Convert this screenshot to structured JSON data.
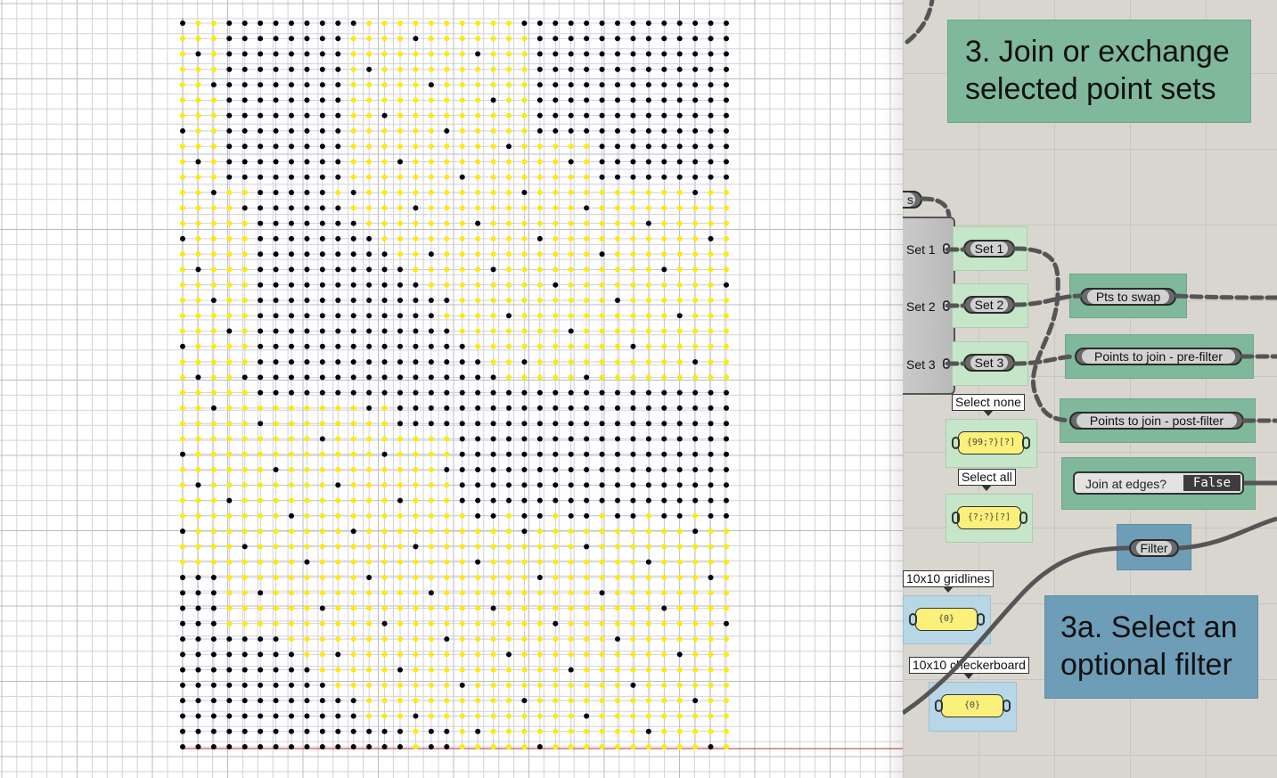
{
  "viewport": {
    "grid_cols": 36,
    "grid_rows": 48,
    "point_colors": {
      "selected": "#ffeb00",
      "unselected": "#000000"
    }
  },
  "canvas": {
    "note_join": "3. Join or exchange\nselected point sets",
    "note_filter": "3a. Select an\noptional filter",
    "param_s": "s",
    "component_outputs": [
      "Set 1",
      "Set 2",
      "Set 3"
    ],
    "set_params": [
      "Set 1",
      "Set 2",
      "Set 3"
    ],
    "pts_to_swap": "Pts to swap",
    "points_join_pre": "Points to join - pre-filter",
    "points_join_post": "Points to join - post-filter",
    "select_none_label": "Select none",
    "select_none_value": "{99;?}[?]",
    "select_all_label": "Select all",
    "select_all_value": "{?;?}[?]",
    "join_edges_label": "Join at edges?",
    "join_edges_value": "False",
    "filter_label": "Filter",
    "gridlines_label": "10x10 gridlines",
    "gridlines_value": "{0}",
    "checker_label": "10x10 checkerboard",
    "checker_value": "{0}",
    "colors": {
      "green_group": "#7fb89a",
      "light_green_group": "#c6e6c9",
      "blue_group": "#6e9db8",
      "light_blue_group": "#b7d6e6",
      "panel_yellow": "#fbf17a"
    }
  }
}
